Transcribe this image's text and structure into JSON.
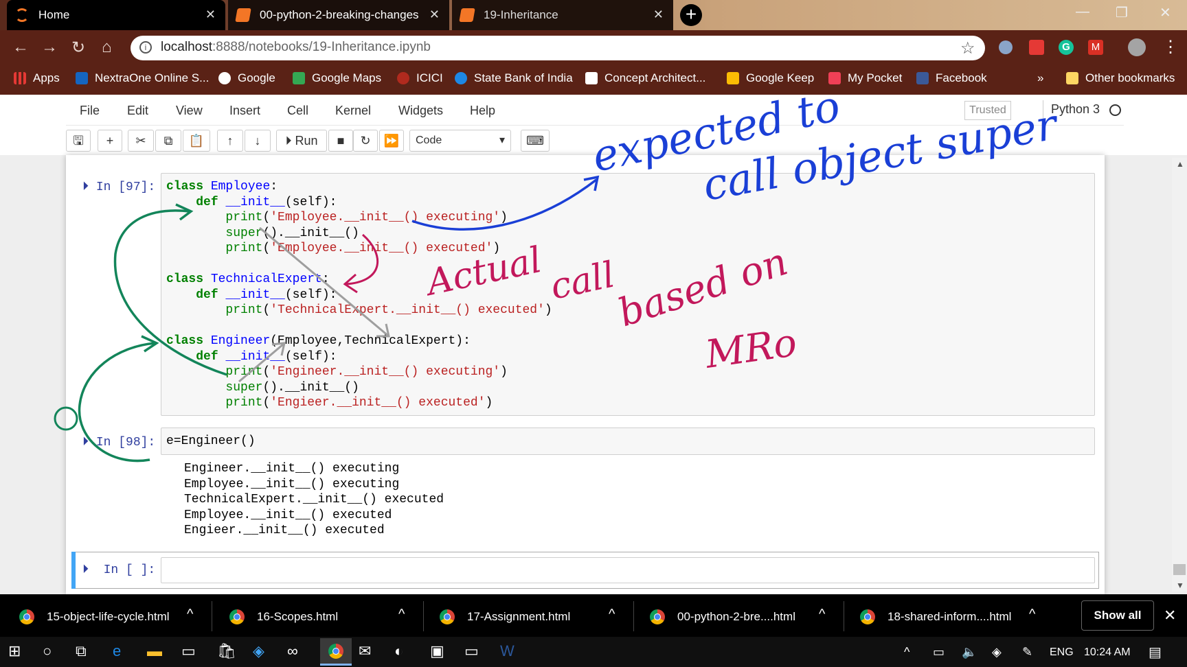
{
  "browser": {
    "tabs": [
      {
        "title": "Home"
      },
      {
        "title": "00-python-2-breaking-changes"
      },
      {
        "title": "19-Inheritance"
      }
    ],
    "url_host": "localhost",
    "url_path": ":8888/notebooks/19-Inheritance.ipynb",
    "bookmarks": [
      "Apps",
      "NextraOne Online S...",
      "Google",
      "Google Maps",
      "ICICI",
      "State Bank of India",
      "Concept Architect...",
      "Google Keep",
      "My Pocket",
      "Facebook"
    ],
    "bookmarks_overflow": "»",
    "other_bookmarks": "Other bookmarks"
  },
  "jupyter": {
    "menu": [
      "File",
      "Edit",
      "View",
      "Insert",
      "Cell",
      "Kernel",
      "Widgets",
      "Help"
    ],
    "trusted": "Trusted",
    "kernel": "Python 3",
    "run_label": "Run",
    "cell_type": "Code",
    "cells": [
      {
        "prompt": "In [97]:"
      },
      {
        "prompt": "In [98]:",
        "code": "e=Engineer()"
      },
      {
        "prompt": "In [ ]:"
      }
    ],
    "output": [
      "Engineer.__init__() executing",
      "Employee.__init__() executing",
      "TechnicalExpert.__init__() executed",
      "Employee.__init__() executed",
      "Engieer.__init__() executed"
    ]
  },
  "annotations": {
    "blue": [
      "expected to",
      "call object super"
    ],
    "magenta": [
      "Actual",
      "call",
      "based on",
      "MRo"
    ]
  },
  "downloads": [
    "15-object-life-cycle.html",
    "16-Scopes.html",
    "17-Assignment.html",
    "00-python-2-bre....html",
    "18-shared-inform....html"
  ],
  "show_all": "Show all",
  "taskbar": {
    "lang": "ENG",
    "time": "10:24 AM"
  },
  "colors": {
    "annotation_blue": "#1a3fd6",
    "annotation_magenta": "#c2185b",
    "annotation_green": "#13855a",
    "arrow_grey": "#9e9e9e",
    "cell_select": "#42a5f5"
  }
}
